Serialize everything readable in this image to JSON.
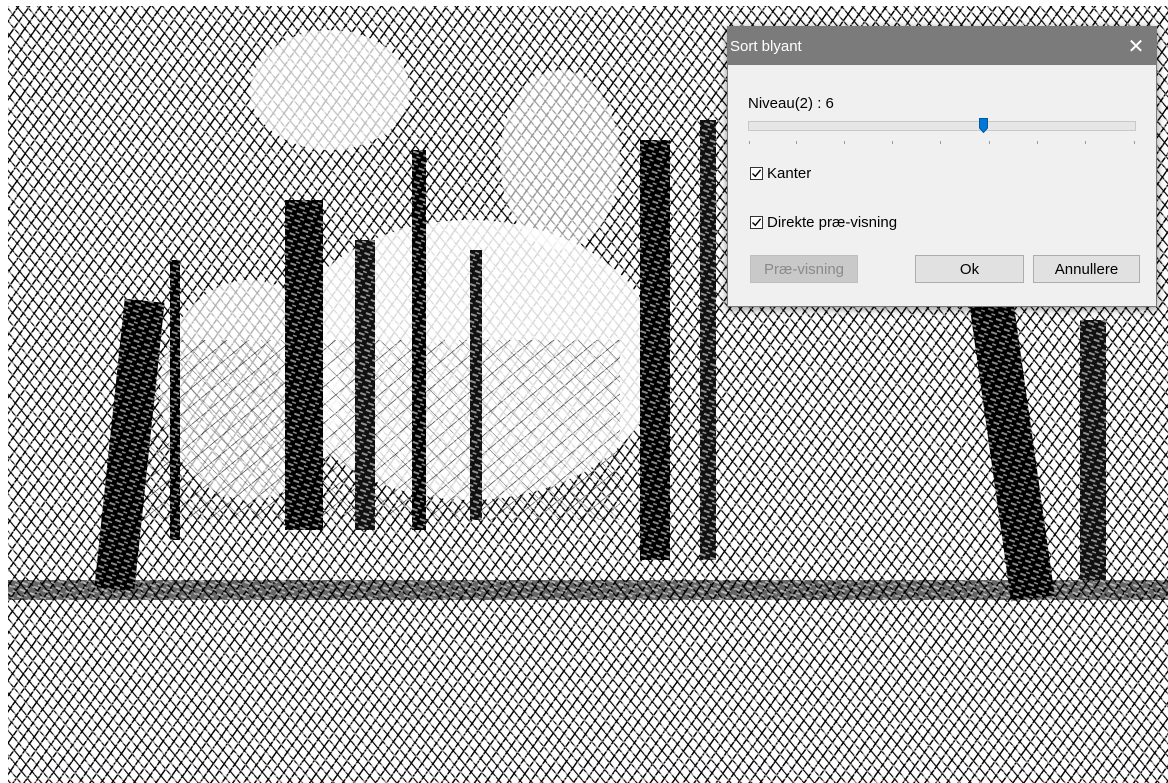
{
  "dialog": {
    "title": "Sort blyant",
    "close_glyph": "✕",
    "level_label": "Niveau(2) : 6",
    "slider": {
      "value": 6,
      "min": 0,
      "max": 10
    },
    "edges": {
      "label": "Kanter",
      "checked": true
    },
    "live_preview": {
      "label": "Direkte præ-visning",
      "checked": true
    },
    "buttons": {
      "preview": "Præ-visning",
      "ok": "Ok",
      "cancel": "Annullere"
    }
  },
  "icons": {
    "close": "close-icon",
    "check": "check-icon",
    "slider_thumb": "slider-thumb-icon"
  },
  "colors": {
    "titlebar": "#7b7b7b",
    "dialog_bg": "#f0f0f0",
    "slider_thumb": "#0078d7",
    "sketch_ink": "#000000"
  }
}
